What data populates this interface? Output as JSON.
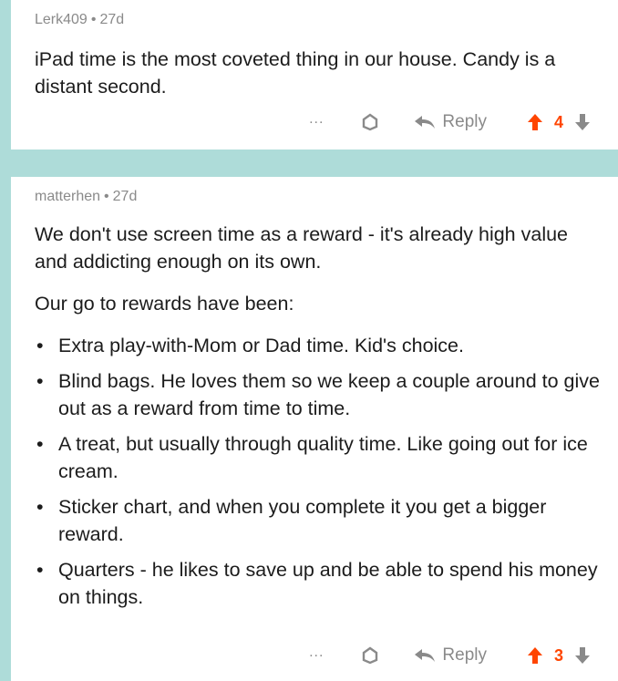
{
  "comments": [
    {
      "username": "Lerk409",
      "separator": "•",
      "age": "27d",
      "paragraphs": [
        "iPad time is the most coveted thing in our house. Candy is a distant second."
      ],
      "bullets": [],
      "actions": {
        "more": "...",
        "reply": "Reply",
        "score": "4"
      }
    },
    {
      "username": "matterhen",
      "separator": "•",
      "age": "27d",
      "paragraphs": [
        "We don't use screen time as a reward - it's already high value and addicting enough on its own.",
        "Our go to rewards have been:"
      ],
      "bullets": [
        "Extra play-with-Mom or Dad time.  Kid's choice.",
        "Blind bags.  He loves them so we keep a couple around to give out as a reward from time to time.",
        "A treat, but usually through quality time.  Like going out for ice cream.",
        "Sticker chart, and when you complete it you get a bigger reward.",
        "Quarters - he likes to save up and be able to spend his money on things."
      ],
      "actions": {
        "more": "...",
        "reply": "Reply",
        "score": "3"
      }
    }
  ],
  "colors": {
    "background": "#aedcd9",
    "upvote": "#ff4500",
    "muted": "#8a8a8a"
  },
  "icons": {
    "more": "more-dots-icon",
    "award": "award-icon",
    "reply": "reply-arrow-icon",
    "upvote": "upvote-arrow-icon",
    "downvote": "downvote-arrow-icon"
  }
}
